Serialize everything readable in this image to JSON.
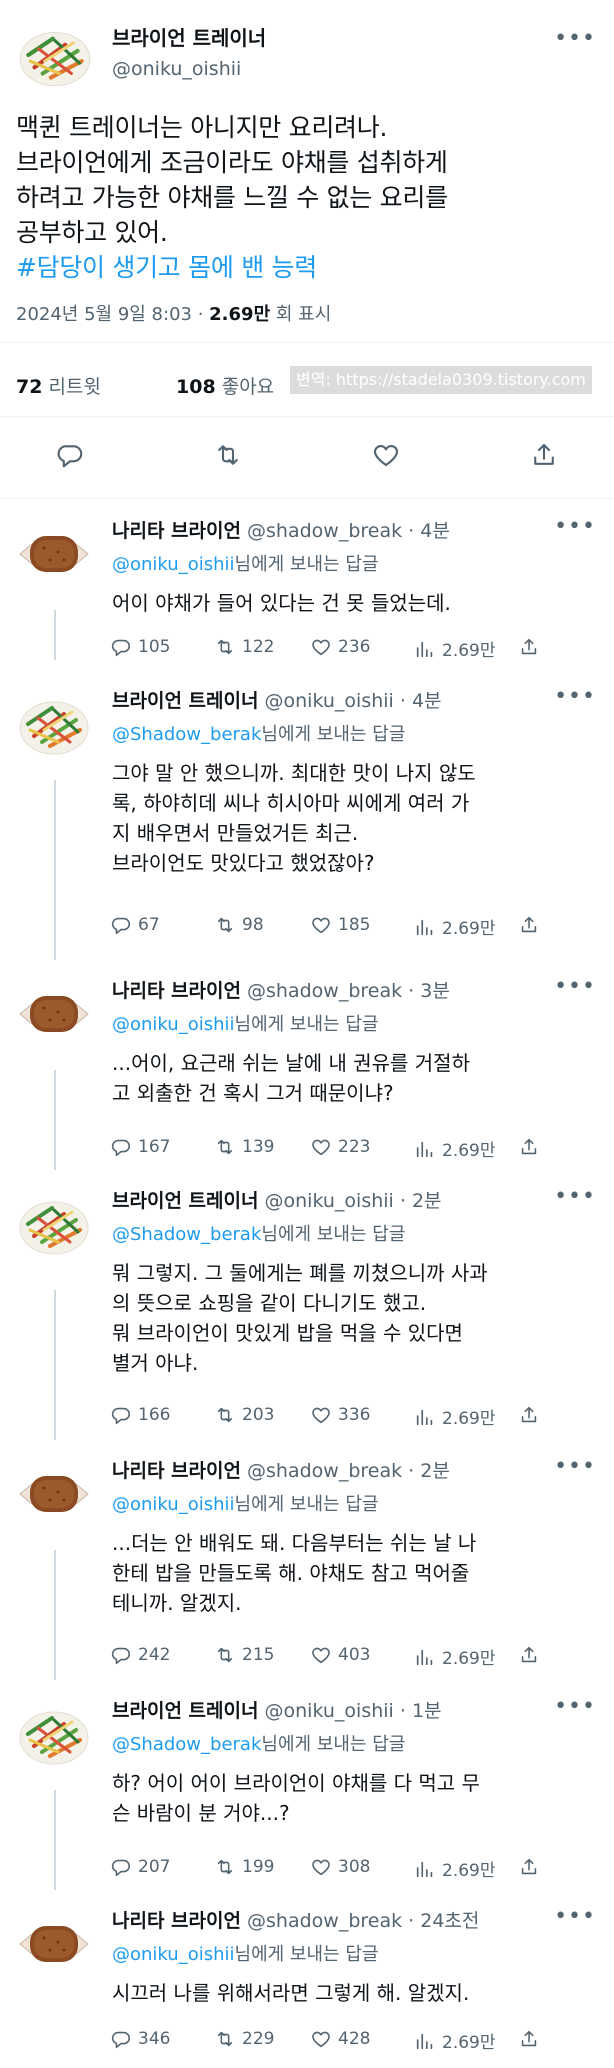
{
  "main": {
    "author_name": "브라이언 트레이너",
    "author_handle": "@oniku_oishii",
    "text_lines": [
      "맥퀸 트레이너는 아니지만 요리려나.",
      "브라이언에게 조금이라도 야채를 섭취하게",
      "하려고 가능한 야채를 느낄 수 없는 요리를",
      "공부하고 있어."
    ],
    "hashtag": "#담당이 생기고 몸에 밴 능력",
    "date": "2024년 5월 9일  8:03 · ",
    "views": "2.69만",
    "views_label": " 회 표시",
    "retweets": "72",
    "retweets_label": "리트윗",
    "likes": "108",
    "likes_label": "좋아요",
    "watermark": "변역: https://stadela0309.tistory.com"
  },
  "replies": [
    {
      "name": "나리타 브라이언",
      "handle": "@shadow_break · 4분",
      "to": "@oniku_oishii",
      "to_suffix": "님에게 보내는 답글",
      "text": "어이 야채가 들어 있다는 건 못 들었는데.",
      "replies": "105",
      "retweets": "122",
      "likes": "236",
      "views": "2.69만"
    },
    {
      "name": "브라이언 트레이너",
      "handle": "@oniku_oishii · 4분",
      "to": "@Shadow_berak",
      "to_suffix": "님에게 보내는 답글",
      "text": "그야 말 안 했으니까. 최대한 맛이 나지 않도\n록, 하야히데 씨나 히시아마 씨에게 여러 가\n지 배우면서 만들었거든 최근.\n브라이언도 맛있다고 했었잖아?",
      "replies": "67",
      "retweets": "98",
      "likes": "185",
      "views": "2.69만"
    },
    {
      "name": "나리타 브라이언",
      "handle": "@shadow_break · 3분",
      "to": "@oniku_oishii",
      "to_suffix": "님에게 보내는 답글",
      "text": "...어이, 요근래 쉬는 날에 내 권유를 거절하\n고 외출한 건 혹시 그거 때문이냐?",
      "replies": "167",
      "retweets": "139",
      "likes": "223",
      "views": "2.69만"
    },
    {
      "name": "브라이언 트레이너",
      "handle": "@oniku_oishii · 2분",
      "to": "@Shadow_berak",
      "to_suffix": "님에게 보내는 답글",
      "text": "뭐 그렇지. 그 둘에게는 폐를 끼쳤으니까 사과\n의 뜻으로 쇼핑을 같이 다니기도 했고.\n뭐 브라이언이 맛있게 밥을 먹을 수 있다면\n별거 아냐.",
      "replies": "166",
      "retweets": "203",
      "likes": "336",
      "views": "2.69만"
    },
    {
      "name": "나리타 브라이언",
      "handle": "@shadow_break · 2분",
      "to": "@oniku_oishii",
      "to_suffix": "님에게 보내는 답글",
      "text": "...더는 안 배워도 돼. 다음부터는 쉬는 날 나\n한테 밥을 만들도록 해. 야채도 참고 먹어줄\n테니까. 알겠지.",
      "replies": "242",
      "retweets": "215",
      "likes": "403",
      "views": "2.69만"
    },
    {
      "name": "브라이언 트레이너",
      "handle": "@oniku_oishii · 1분",
      "to": "@Shadow_berak",
      "to_suffix": "님에게 보내는 답글",
      "text": "하? 어이 어이 브라이언이 야채를 다 먹고 무\n슨 바람이 분 거야...?",
      "replies": "207",
      "retweets": "199",
      "likes": "308",
      "views": "2.69만"
    },
    {
      "name": "나리타 브라이언",
      "handle": "@shadow_break · 24초전",
      "to": "@oniku_oishii",
      "to_suffix": "님에게 보내는 답글",
      "text": "시끄러 나를 위해서라면 그렇게 해. 알겠지.",
      "replies": "346",
      "retweets": "229",
      "likes": "428",
      "views": "2.69만"
    }
  ]
}
